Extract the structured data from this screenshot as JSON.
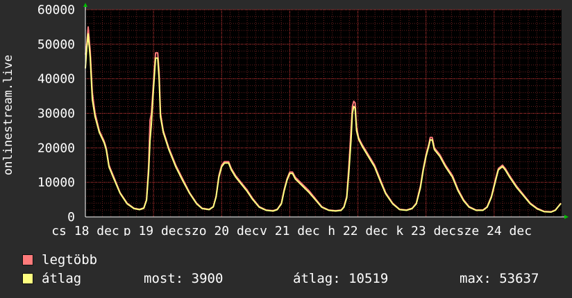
{
  "chart_data": {
    "type": "line",
    "ylabel": "onlinestream.live",
    "ylim": [
      0,
      60000
    ],
    "yticks": [
      0,
      10000,
      20000,
      30000,
      40000,
      50000,
      60000
    ],
    "xlim": [
      0,
      685
    ],
    "xticks": [
      {
        "pos": 0,
        "label": "cs 18 dec"
      },
      {
        "pos": 98,
        "label": "p 19 dec"
      },
      {
        "pos": 196,
        "label": "szo 20 dec"
      },
      {
        "pos": 294,
        "label": "v 21 dec"
      },
      {
        "pos": 392,
        "label": "h 22 dec"
      },
      {
        "pos": 490,
        "label": "k 23 dec"
      },
      {
        "pos": 588,
        "label": "sze 24 dec"
      }
    ],
    "grid": true,
    "series": [
      {
        "name": "legtöbb",
        "color": "#ff7b7b",
        "points": [
          [
            0,
            47000
          ],
          [
            2,
            50000
          ],
          [
            4,
            55000
          ],
          [
            7,
            48000
          ],
          [
            10,
            36000
          ],
          [
            14,
            30000
          ],
          [
            20,
            25000
          ],
          [
            27,
            22000
          ],
          [
            30,
            20000
          ],
          [
            34,
            15000
          ],
          [
            40,
            12000
          ],
          [
            50,
            7000
          ],
          [
            60,
            4000
          ],
          [
            70,
            2500
          ],
          [
            78,
            2200
          ],
          [
            84,
            2600
          ],
          [
            88,
            5000
          ],
          [
            91,
            15000
          ],
          [
            93,
            28000
          ],
          [
            95,
            30000
          ],
          [
            97,
            36000
          ],
          [
            99,
            42000
          ],
          [
            101,
            47500
          ],
          [
            104,
            47500
          ],
          [
            106,
            42000
          ],
          [
            108,
            30000
          ],
          [
            112,
            25000
          ],
          [
            120,
            20000
          ],
          [
            130,
            15000
          ],
          [
            140,
            11000
          ],
          [
            150,
            7000
          ],
          [
            160,
            4000
          ],
          [
            168,
            2500
          ],
          [
            178,
            2200
          ],
          [
            184,
            3000
          ],
          [
            188,
            6000
          ],
          [
            192,
            12000
          ],
          [
            196,
            15000
          ],
          [
            200,
            16000
          ],
          [
            206,
            16000
          ],
          [
            210,
            14000
          ],
          [
            216,
            12000
          ],
          [
            224,
            10000
          ],
          [
            232,
            8000
          ],
          [
            240,
            5500
          ],
          [
            250,
            3000
          ],
          [
            260,
            2000
          ],
          [
            270,
            1800
          ],
          [
            276,
            2200
          ],
          [
            282,
            4000
          ],
          [
            286,
            8000
          ],
          [
            290,
            11000
          ],
          [
            294,
            13000
          ],
          [
            298,
            13000
          ],
          [
            302,
            11500
          ],
          [
            312,
            9500
          ],
          [
            322,
            7500
          ],
          [
            332,
            5000
          ],
          [
            340,
            3000
          ],
          [
            350,
            2000
          ],
          [
            360,
            1800
          ],
          [
            368,
            2000
          ],
          [
            372,
            3000
          ],
          [
            376,
            6000
          ],
          [
            379,
            15000
          ],
          [
            382,
            25000
          ],
          [
            384,
            32000
          ],
          [
            386,
            33500
          ],
          [
            388,
            33000
          ],
          [
            390,
            26000
          ],
          [
            393,
            23000
          ],
          [
            398,
            21000
          ],
          [
            404,
            19000
          ],
          [
            410,
            17000
          ],
          [
            416,
            15000
          ],
          [
            424,
            11000
          ],
          [
            432,
            7000
          ],
          [
            442,
            4000
          ],
          [
            452,
            2200
          ],
          [
            462,
            2000
          ],
          [
            470,
            2500
          ],
          [
            476,
            4000
          ],
          [
            482,
            9000
          ],
          [
            486,
            14000
          ],
          [
            490,
            18000
          ],
          [
            494,
            21000
          ],
          [
            496,
            23000
          ],
          [
            499,
            23000
          ],
          [
            502,
            20000
          ],
          [
            510,
            18000
          ],
          [
            518,
            15000
          ],
          [
            528,
            12000
          ],
          [
            536,
            8000
          ],
          [
            544,
            5000
          ],
          [
            552,
            3000
          ],
          [
            562,
            2000
          ],
          [
            572,
            2000
          ],
          [
            578,
            3000
          ],
          [
            584,
            6000
          ],
          [
            590,
            11000
          ],
          [
            594,
            14000
          ],
          [
            600,
            15000
          ],
          [
            604,
            14000
          ],
          [
            610,
            12000
          ],
          [
            620,
            9000
          ],
          [
            630,
            6500
          ],
          [
            640,
            4000
          ],
          [
            650,
            2500
          ],
          [
            660,
            1600
          ],
          [
            670,
            1500
          ],
          [
            676,
            2000
          ],
          [
            680,
            3000
          ],
          [
            684,
            4000
          ]
        ]
      },
      {
        "name": "átlag",
        "color": "#ffff80",
        "points": [
          [
            0,
            43000
          ],
          [
            2,
            49000
          ],
          [
            4,
            53000
          ],
          [
            7,
            46000
          ],
          [
            10,
            34000
          ],
          [
            14,
            29000
          ],
          [
            20,
            24500
          ],
          [
            27,
            21500
          ],
          [
            30,
            19500
          ],
          [
            34,
            14500
          ],
          [
            40,
            11500
          ],
          [
            50,
            6800
          ],
          [
            60,
            3800
          ],
          [
            70,
            2400
          ],
          [
            78,
            2100
          ],
          [
            84,
            2500
          ],
          [
            88,
            4800
          ],
          [
            91,
            13000
          ],
          [
            93,
            22000
          ],
          [
            95,
            27000
          ],
          [
            97,
            34000
          ],
          [
            99,
            40000
          ],
          [
            101,
            46000
          ],
          [
            104,
            46000
          ],
          [
            106,
            40000
          ],
          [
            108,
            29000
          ],
          [
            112,
            24500
          ],
          [
            120,
            19500
          ],
          [
            130,
            14500
          ],
          [
            140,
            10500
          ],
          [
            150,
            6800
          ],
          [
            160,
            3800
          ],
          [
            168,
            2400
          ],
          [
            178,
            2100
          ],
          [
            184,
            2900
          ],
          [
            188,
            5800
          ],
          [
            192,
            11500
          ],
          [
            196,
            14500
          ],
          [
            200,
            15600
          ],
          [
            206,
            15600
          ],
          [
            210,
            13600
          ],
          [
            216,
            11600
          ],
          [
            224,
            9600
          ],
          [
            232,
            7600
          ],
          [
            240,
            5200
          ],
          [
            250,
            2800
          ],
          [
            260,
            1900
          ],
          [
            270,
            1700
          ],
          [
            276,
            2100
          ],
          [
            282,
            3800
          ],
          [
            286,
            7600
          ],
          [
            290,
            10600
          ],
          [
            294,
            12600
          ],
          [
            298,
            12600
          ],
          [
            302,
            11000
          ],
          [
            312,
            9000
          ],
          [
            322,
            7000
          ],
          [
            332,
            4700
          ],
          [
            340,
            2800
          ],
          [
            350,
            1900
          ],
          [
            360,
            1700
          ],
          [
            368,
            1900
          ],
          [
            372,
            2800
          ],
          [
            376,
            5500
          ],
          [
            379,
            13000
          ],
          [
            382,
            22000
          ],
          [
            384,
            30000
          ],
          [
            386,
            32000
          ],
          [
            388,
            31500
          ],
          [
            390,
            25000
          ],
          [
            393,
            22500
          ],
          [
            398,
            20500
          ],
          [
            404,
            18500
          ],
          [
            410,
            16500
          ],
          [
            416,
            14500
          ],
          [
            424,
            10500
          ],
          [
            432,
            6700
          ],
          [
            442,
            3800
          ],
          [
            452,
            2100
          ],
          [
            462,
            1900
          ],
          [
            470,
            2400
          ],
          [
            476,
            3800
          ],
          [
            482,
            8500
          ],
          [
            486,
            13500
          ],
          [
            490,
            17500
          ],
          [
            494,
            20500
          ],
          [
            496,
            22300
          ],
          [
            499,
            22300
          ],
          [
            502,
            19500
          ],
          [
            510,
            17500
          ],
          [
            518,
            14500
          ],
          [
            528,
            11500
          ],
          [
            536,
            7600
          ],
          [
            544,
            4700
          ],
          [
            552,
            2800
          ],
          [
            562,
            1900
          ],
          [
            572,
            1900
          ],
          [
            578,
            2800
          ],
          [
            584,
            5700
          ],
          [
            590,
            10500
          ],
          [
            594,
            13600
          ],
          [
            600,
            14600
          ],
          [
            604,
            13600
          ],
          [
            610,
            11600
          ],
          [
            620,
            8600
          ],
          [
            630,
            6200
          ],
          [
            640,
            3800
          ],
          [
            650,
            2300
          ],
          [
            660,
            1500
          ],
          [
            670,
            1400
          ],
          [
            676,
            1900
          ],
          [
            680,
            2900
          ],
          [
            684,
            3900
          ]
        ]
      }
    ]
  },
  "legend": {
    "items": [
      {
        "label": "legtöbb",
        "color": "#ff7b7b"
      },
      {
        "label": "átlag",
        "color": "#ffff80"
      }
    ]
  },
  "stats": {
    "most": "most: 3900",
    "atlag": "átlag: 10519",
    "max": "max: 53637"
  }
}
